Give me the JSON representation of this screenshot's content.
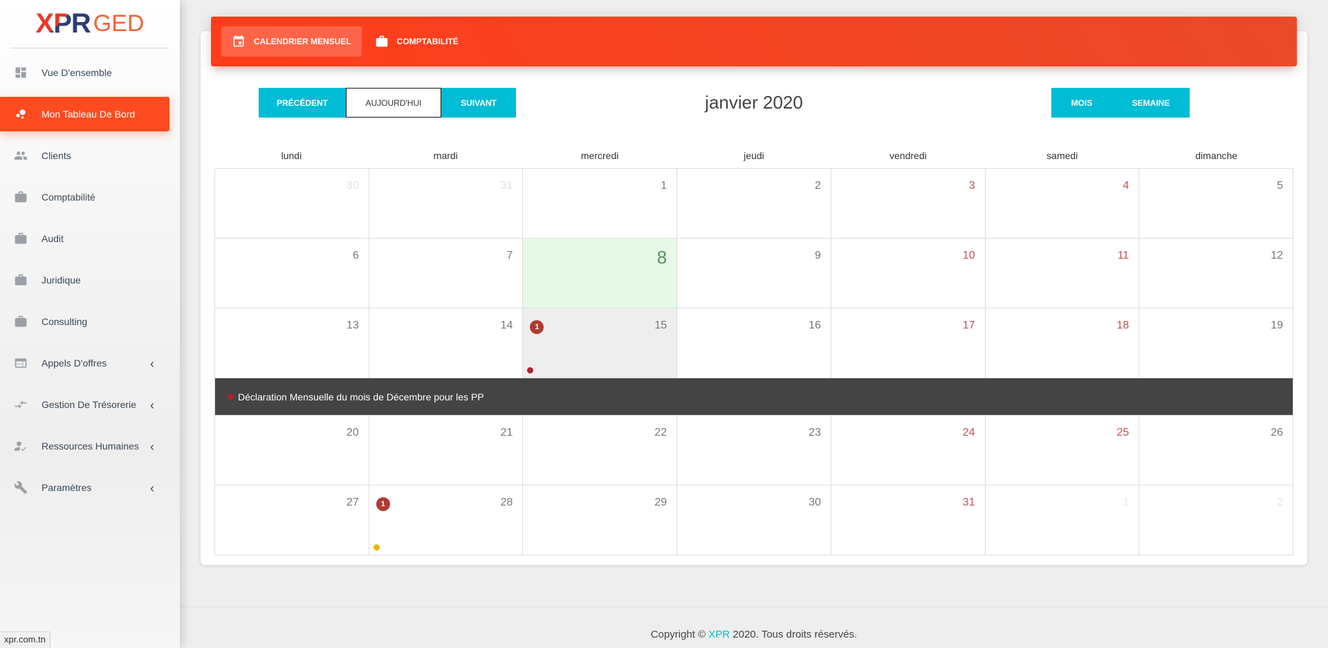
{
  "logo": {
    "part1": "XPR",
    "part2": "GED"
  },
  "sidebar": {
    "items": [
      {
        "label": "Vue D'ensemble",
        "icon": "dashboard-icon",
        "active": false,
        "submenu": false
      },
      {
        "label": "Mon Tableau De Bord",
        "icon": "bubble-chart-icon",
        "active": true,
        "submenu": false
      },
      {
        "label": "Clients",
        "icon": "people-icon",
        "active": false,
        "submenu": false
      },
      {
        "label": "Comptabilité",
        "icon": "briefcase-icon",
        "active": false,
        "submenu": false
      },
      {
        "label": "Audit",
        "icon": "briefcase-icon",
        "active": false,
        "submenu": false
      },
      {
        "label": "Juridique",
        "icon": "briefcase-icon",
        "active": false,
        "submenu": false
      },
      {
        "label": "Consulting",
        "icon": "briefcase-icon",
        "active": false,
        "submenu": false
      },
      {
        "label": "Appels D'offres",
        "icon": "web-icon",
        "active": false,
        "submenu": true
      },
      {
        "label": "Gestion De Trésorerie",
        "icon": "compare-arrows-icon",
        "active": false,
        "submenu": true
      },
      {
        "label": "Ressources Humaines",
        "icon": "person-check-icon",
        "active": false,
        "submenu": true
      },
      {
        "label": "Paramètres",
        "icon": "wrench-icon",
        "active": false,
        "submenu": true
      }
    ]
  },
  "header": {
    "tabs": [
      {
        "label": "CALENDRIER MENSUEL",
        "icon": "calendar-icon",
        "active": true
      },
      {
        "label": "COMPTABILITÉ",
        "icon": "briefcase-icon",
        "active": false
      }
    ]
  },
  "toolbar": {
    "prev": "PRÉCÉDENT",
    "today": "AUJOURD'HUI",
    "next": "SUIVANT",
    "month_title": "janvier 2020",
    "view_month": "MOIS",
    "view_week": "SEMAINE"
  },
  "calendar": {
    "weekdays": [
      "lundi",
      "mardi",
      "mercredi",
      "jeudi",
      "vendredi",
      "samedi",
      "dimanche"
    ],
    "weeks": [
      [
        "30",
        "31",
        "1",
        "2",
        "3",
        "4",
        "5"
      ],
      [
        "6",
        "7",
        "8",
        "9",
        "10",
        "11",
        "12"
      ],
      [
        "13",
        "14",
        "15",
        "16",
        "17",
        "18",
        "19"
      ],
      [
        "20",
        "21",
        "22",
        "23",
        "24",
        "25",
        "26"
      ],
      [
        "27",
        "28",
        "29",
        "30",
        "31",
        "1",
        "2"
      ]
    ],
    "badges": {
      "w2d2": "1",
      "w4d1": "1"
    },
    "event_title": "Déclaration Mensuelle du mois de Décembre pour les PP",
    "colors": {
      "event_red": "#b0232a",
      "event_yellow": "#e6b800",
      "today_bg": "#e6f9e6",
      "weekend_text": "#c25252"
    }
  },
  "footer": {
    "prefix": "Copyright © ",
    "brand": "XPR",
    "suffix": " 2020. Tous droits réservés."
  },
  "status_url": "xpr.com.tn"
}
